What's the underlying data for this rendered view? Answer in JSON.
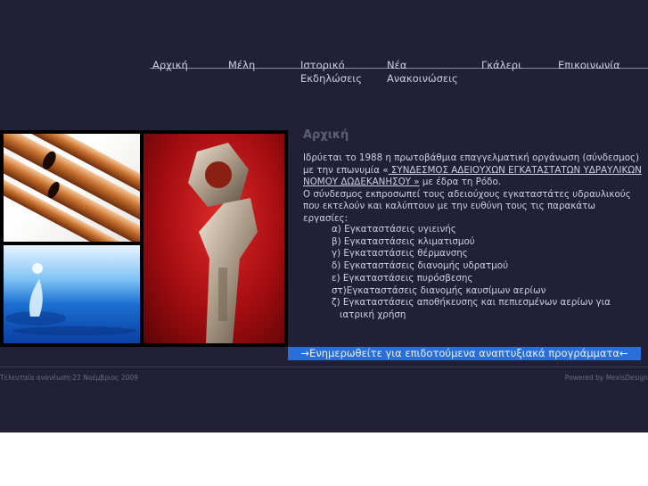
{
  "nav": {
    "items": [
      {
        "label": "Αρχική"
      },
      {
        "label": "Μέλη"
      },
      {
        "label": "Ιστορικό",
        "label2": "Εκδηλώσεις"
      },
      {
        "label": "Νέα",
        "label2": "Ανακοινώσεις"
      },
      {
        "label": "Γκάλερι"
      },
      {
        "label": "Επικοινωνία"
      }
    ]
  },
  "main": {
    "title": "Αρχική",
    "intro": {
      "p1_start": "Ιδρύεται το 1988 η πρωτοβάθμια επαγγελματική οργάνωση (σύνδεσμος) με την επωνυμία «",
      "p1_name": " ΣΥΝΔΕΣΜΟΣ ΑΔΕΙΟΥΧΩΝ ΕΓΚΑΤΑΣΤΑΤΩΝ ΥΔΡΑΥΛΙΚΩΝ ΝΟΜΟΥ ΔΩΔΕΚΑΝΗΣΟΥ »",
      "p1_end": " με έδρα τη Ρόδο.",
      "p2": "Ο σύνδεσμος εκπροσωπεί τους αδειούχους εγκαταστάτες υδραυλικούς που εκτελούν και καλύπτουν με την ευθύνη τους τις παρακάτω εργασίες:"
    },
    "works": [
      "α) Εγκαταστάσεις υγιεινής",
      "β) Εγκαταστάσεις κλιματισμού",
      "γ) Εγκαταστάσεις θέρμανσης",
      "δ) Εγκαταστάσεις διανομής υδρατμού",
      "ε) Εγκαταστάσεις πυρόσβεσης",
      "στ)Εγκαταστάσεις διανομής καυσίμων αερίων",
      "ζ) Εγκαταστάσεις αποθήκευσης και πεπιεσμένων αερίων για",
      "ιατρική χρήση"
    ],
    "banner": "→Ενημερωθείτε για επιδοτούμενα αναπτυξιακά προγράμματα←"
  },
  "footer": {
    "last_update": "Τελευταία ανανέωση:22 Νοέμβριος 2009",
    "powered": "Powered by MexisDesign"
  },
  "colors": {
    "background": "#222036",
    "banner": "#2a6ed8",
    "text": "#cfcde0"
  }
}
